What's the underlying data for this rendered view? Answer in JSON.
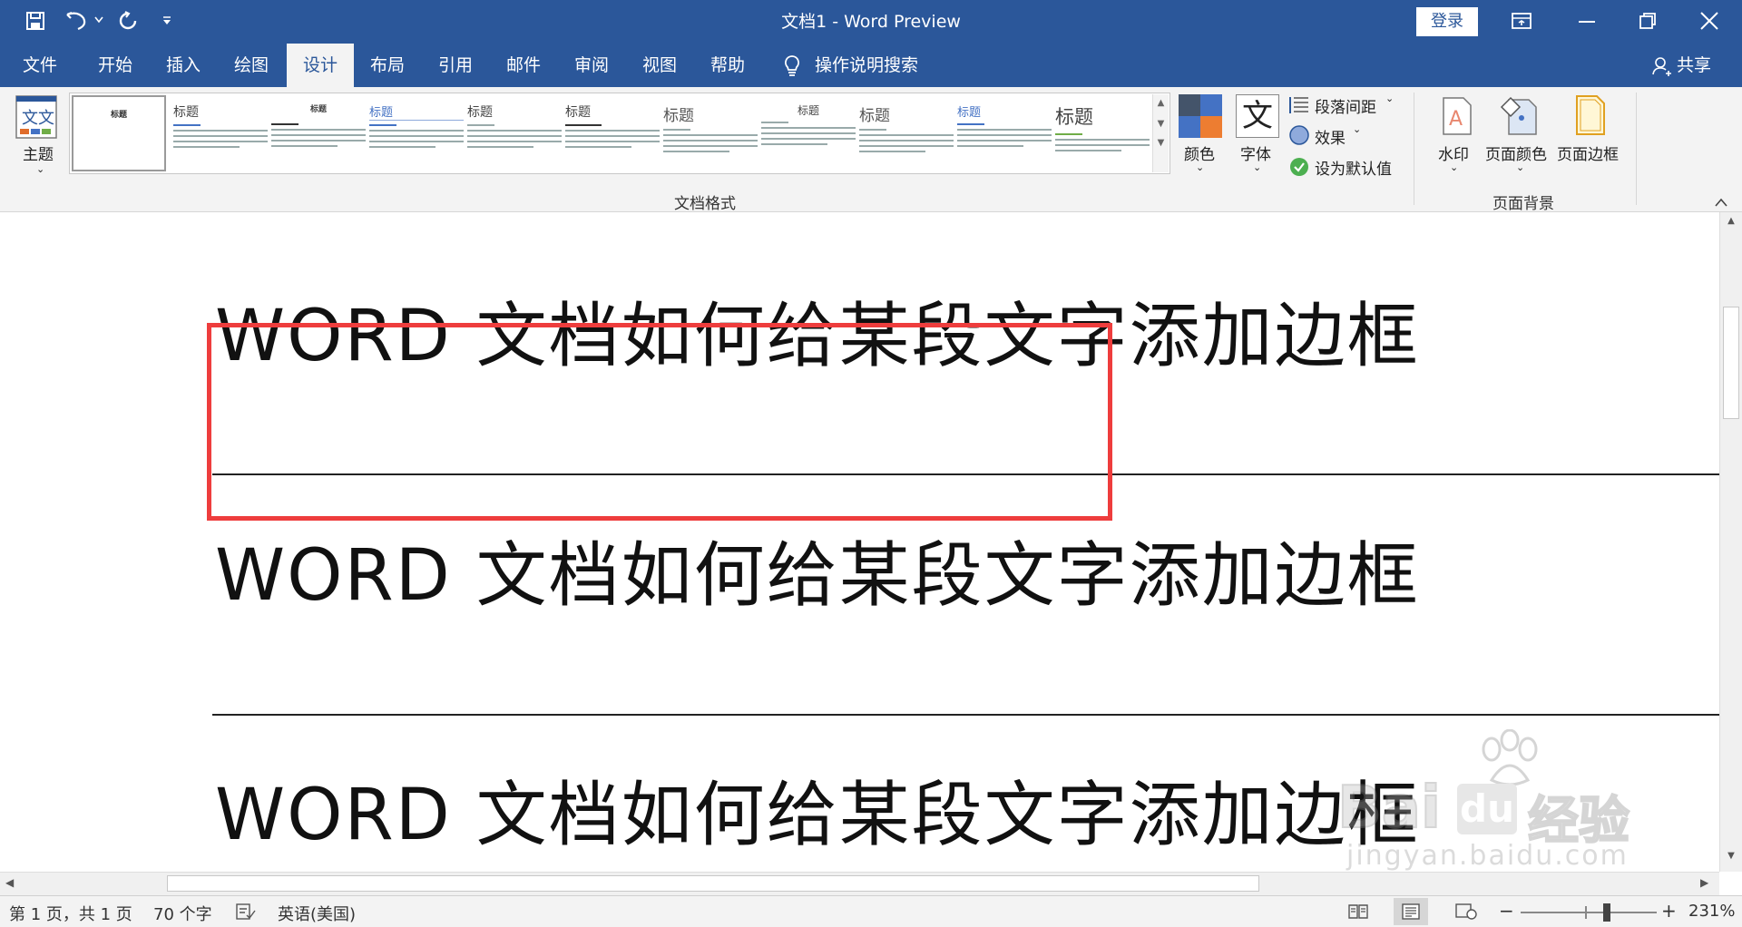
{
  "titlebar": {
    "title": "文档1 - Word Preview",
    "login_label": "登录",
    "icons": [
      "save-icon",
      "undo-icon",
      "redo-icon",
      "customize-qat-icon",
      "ribbon-display-icon",
      "minimize-icon",
      "restore-icon",
      "close-icon"
    ]
  },
  "tabs": [
    "文件",
    "开始",
    "插入",
    "绘图",
    "设计",
    "布局",
    "引用",
    "邮件",
    "审阅",
    "视图",
    "帮助"
  ],
  "active_tab": "设计",
  "tell_me": "操作说明搜索",
  "share_label": "共享",
  "ribbon": {
    "themes_label": "主题",
    "gallery": [
      {
        "title": "标题"
      },
      {
        "title": "标题"
      },
      {
        "title": "标题"
      },
      {
        "title": "标题"
      },
      {
        "title": "标题"
      },
      {
        "title": "标题"
      },
      {
        "title": "标题"
      },
      {
        "title": "标题"
      },
      {
        "title": "标题"
      },
      {
        "title": "标题"
      },
      {
        "title": "标题"
      }
    ],
    "group_doc_format": "文档格式",
    "colors_label": "颜色",
    "fonts_label": "字体",
    "fonts_icon_char": "文",
    "paragraph_spacing": "段落间距",
    "effects": "效果",
    "set_default": "设为默认值",
    "watermark": "水印",
    "page_color": "页面颜色",
    "page_borders": "页面边框",
    "group_page_background": "页面背景"
  },
  "document": {
    "lines": [
      "WORD 文档如何给某段文字添加边框",
      "WORD 文档如何给某段文字添加边框",
      "WORD 文档如何给某段文字添加边框"
    ]
  },
  "statusbar": {
    "page": "第 1 页，共 1 页",
    "words": "70 个字",
    "language": "英语(美国)",
    "zoom": "231%"
  },
  "watermark": {
    "brand": "Bai",
    "brand2": "du",
    "brand3": "经验",
    "url": "jingyan.baidu.com"
  },
  "colors": {
    "accent": "#2b579a",
    "highlight": "#ee3d3d"
  }
}
